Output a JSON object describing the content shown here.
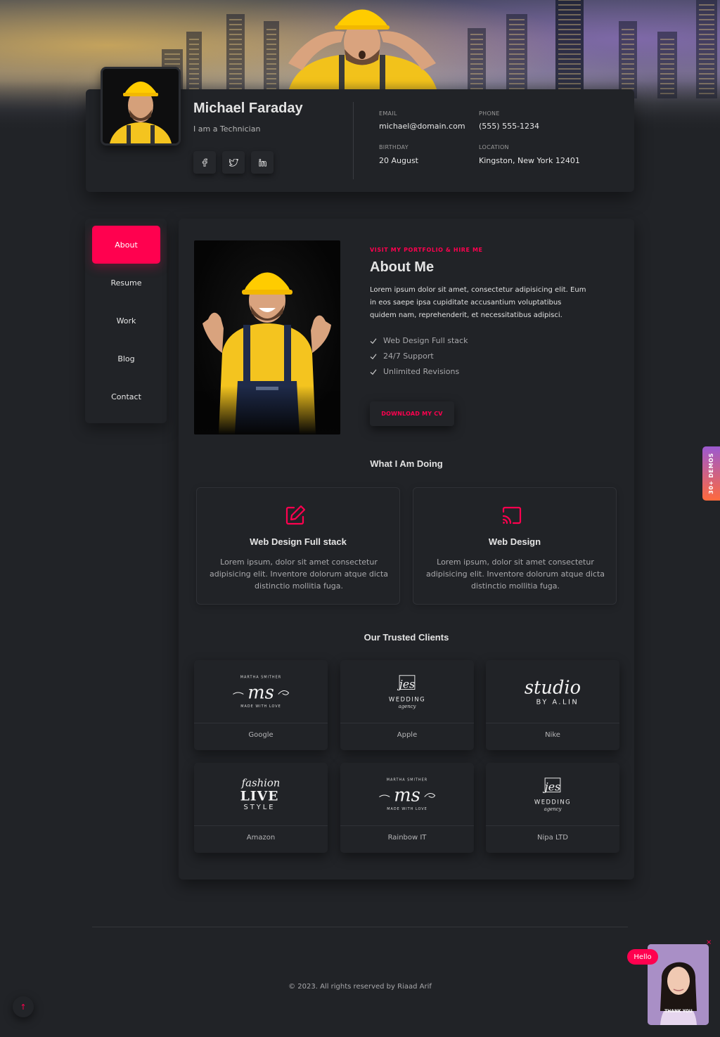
{
  "profile": {
    "name": "Michael Faraday",
    "tagline": "I am a Technician",
    "social": [
      "facebook-icon",
      "twitter-icon",
      "linkedin-icon"
    ],
    "email_label": "EMAIL",
    "email": "michael@domain.com",
    "phone_label": "PHONE",
    "phone": "(555) 555-1234",
    "birthday_label": "BIRTHDAY",
    "birthday": "20 August",
    "location_label": "LOCATION",
    "location": "Kingston, New York 12401"
  },
  "menu": {
    "items": [
      "About",
      "Resume",
      "Work",
      "Blog",
      "Contact"
    ],
    "active": "About",
    "accent": "#ff014f"
  },
  "about": {
    "eyebrow": "VISIT MY PORTFOLIO & HIRE ME",
    "title": "About Me",
    "text": "Lorem ipsum dolor sit amet, consectetur adipisicing elit. Eum in eos saepe ipsa cupiditate accusantium voluptatibus quidem nam, reprehenderit, et necessitatibus adipisci.",
    "features": [
      "Web Design Full stack",
      "24/7 Support",
      "Unlimited Revisions"
    ],
    "cv_button": "DOWNLOAD MY CV"
  },
  "services": {
    "heading": "What I Am Doing",
    "items": [
      {
        "title": "Web Design Full stack",
        "text": "Lorem ipsum, dolor sit amet consectetur adipisicing elit. Inventore dolorum atque dicta distinctio mollitia fuga.",
        "icon": "edit-icon"
      },
      {
        "title": "Web Design",
        "text": "Lorem ipsum, dolor sit amet consectetur adipisicing elit. Inventore dolorum atque dicta distinctio mollitia fuga.",
        "icon": "cast-icon"
      }
    ]
  },
  "clients": {
    "heading": "Our Trusted Clients",
    "items": [
      {
        "name": "Google",
        "logo": "ms-logo"
      },
      {
        "name": "Apple",
        "logo": "wedding-logo"
      },
      {
        "name": "Nike",
        "logo": "studio-logo"
      },
      {
        "name": "Amazon",
        "logo": "fashion-live-style-logo"
      },
      {
        "name": "Rainbow IT",
        "logo": "ms-logo"
      },
      {
        "name": "Nipa LTD",
        "logo": "wedding-logo"
      }
    ],
    "logo_text": {
      "ms_ring_top": "MARTHA SMITHER",
      "ms_mark": "ms",
      "ms_ring_bottom": "MADE WITH LOVE",
      "wedding_mark": "jes",
      "wedding_word": "WEDDING",
      "wedding_sub": "agency",
      "studio_script": "studio",
      "studio_sub": "BY A.LIN",
      "fashion_script": "fashion",
      "fashion_live": "LIVE",
      "fashion_style": "STYLE"
    }
  },
  "footer": {
    "copyright": "© 2023. All rights reserved by Riaad Arif"
  },
  "widgets": {
    "demos": "30+ DEMOS",
    "hello": "Hello",
    "close": "×",
    "thank_you": "THANK YOU",
    "scroll_top": "↑"
  }
}
